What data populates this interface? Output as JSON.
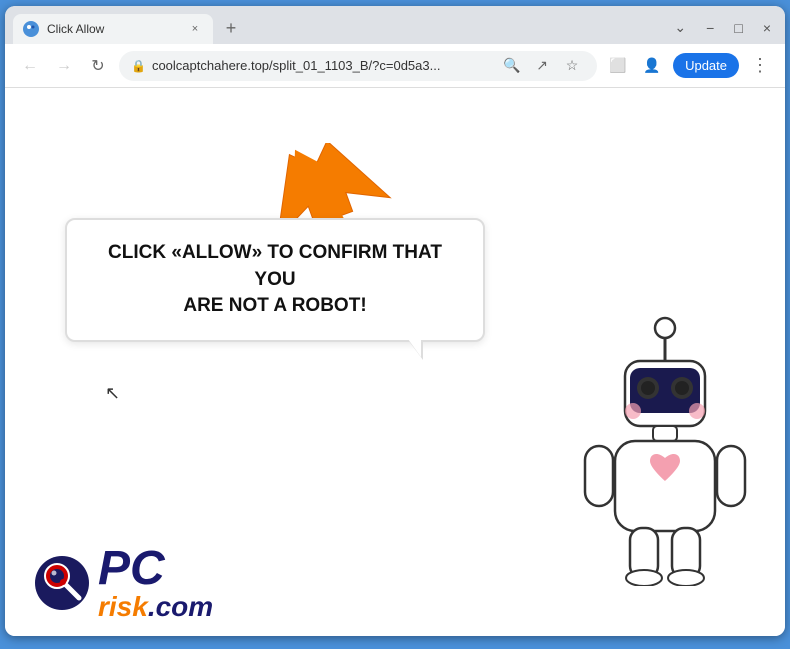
{
  "browser": {
    "tab": {
      "title": "Click Allow",
      "favicon": "🌐"
    },
    "new_tab_label": "+",
    "window_controls": {
      "chevron_down": "⌄",
      "minimize": "−",
      "maximize": "□",
      "close": "×"
    },
    "nav": {
      "back": "←",
      "forward": "→",
      "refresh": "↻"
    },
    "url": "coolcaptchahere.top/split_01_1103_B/?c=0d5a3...",
    "url_actions": {
      "search": "🔍",
      "share": "↗",
      "bookmark": "☆",
      "split": "⬜",
      "profile": "👤"
    },
    "update_label": "Update",
    "menu_label": "⋮"
  },
  "page": {
    "bubble_text_line1": "CLICK «ALLOW» TO CONFIRM THAT YOU",
    "bubble_text_line2": "ARE NOT A ROBOT!"
  },
  "logo": {
    "pc_text": "PC",
    "risk_text": "risk",
    "com_text": ".com"
  },
  "colors": {
    "orange": "#f57c00",
    "dark_blue": "#1a1a6e",
    "browser_chrome": "#dee1e6",
    "update_blue": "#1a73e8"
  }
}
